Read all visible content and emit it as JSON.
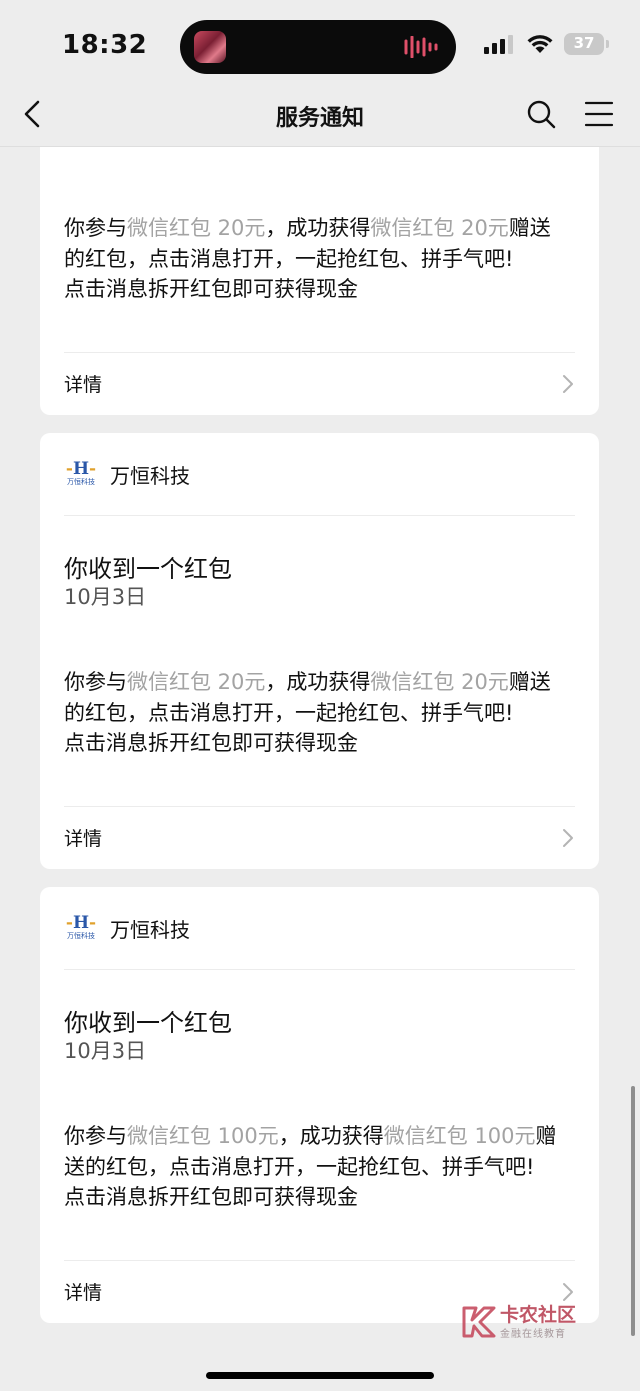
{
  "status_bar": {
    "time": "18:32",
    "battery": "37"
  },
  "nav": {
    "title": "服务通知"
  },
  "cards": [
    {
      "body": {
        "p1": "你参与",
        "amount1": "微信红包 20元",
        "p2": "，成功获得",
        "amount2": "微信红包 20元",
        "p3": "赠送的红包，点击消息打开，一起抢红包、拼手气吧!",
        "line2": "点击消息拆开红包即可获得现金"
      },
      "footer": {
        "detail_label": "详情"
      }
    },
    {
      "sender": {
        "logo_text": "万恒科技",
        "name": "万恒科技"
      },
      "title": "你收到一个红包",
      "date": "10月3日",
      "body": {
        "p1": "你参与",
        "amount1": "微信红包 20元",
        "p2": "，成功获得",
        "amount2": "微信红包 20元",
        "p3": "赠送的红包，点击消息打开，一起抢红包、拼手气吧!",
        "line2": "点击消息拆开红包即可获得现金"
      },
      "footer": {
        "detail_label": "详情"
      }
    },
    {
      "sender": {
        "logo_text": "万恒科技",
        "name": "万恒科技"
      },
      "title": "你收到一个红包",
      "date": "10月3日",
      "body": {
        "p1": "你参与",
        "amount1": "微信红包 100元",
        "p2": "，成功获得",
        "amount2": "微信红包 100元",
        "p3": "赠送的红包，点击消息打开，一起抢红包、拼手气吧!",
        "line2": "点击消息拆开红包即可获得现金"
      },
      "footer": {
        "detail_label": "详情"
      }
    }
  ],
  "watermark": {
    "title": "卡农社区",
    "subtitle": "金融在线教育"
  },
  "colors": {
    "background": "#ededed",
    "card": "#ffffff",
    "muted_text": "#a3a3a3",
    "watermark": "#b63a4d"
  }
}
